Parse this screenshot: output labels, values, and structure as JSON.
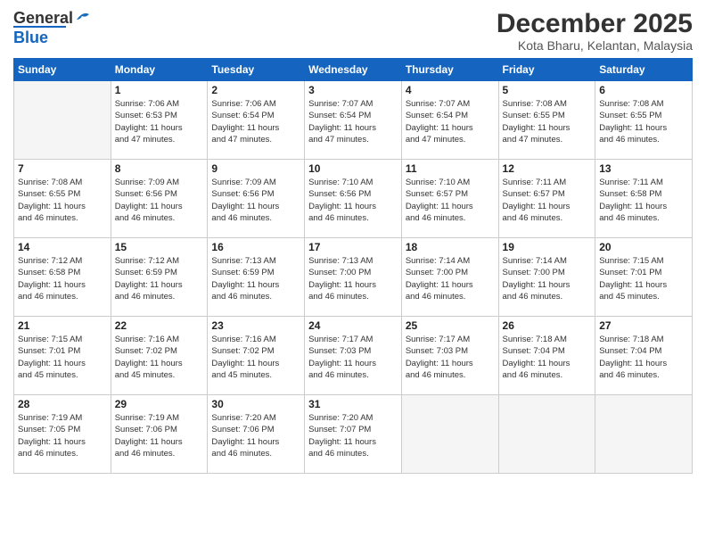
{
  "logo": {
    "line1": "General",
    "line2": "Blue"
  },
  "title": "December 2025",
  "subtitle": "Kota Bharu, Kelantan, Malaysia",
  "weekdays": [
    "Sunday",
    "Monday",
    "Tuesday",
    "Wednesday",
    "Thursday",
    "Friday",
    "Saturday"
  ],
  "weeks": [
    [
      {
        "day": "",
        "info": ""
      },
      {
        "day": "1",
        "info": "Sunrise: 7:06 AM\nSunset: 6:53 PM\nDaylight: 11 hours\nand 47 minutes."
      },
      {
        "day": "2",
        "info": "Sunrise: 7:06 AM\nSunset: 6:54 PM\nDaylight: 11 hours\nand 47 minutes."
      },
      {
        "day": "3",
        "info": "Sunrise: 7:07 AM\nSunset: 6:54 PM\nDaylight: 11 hours\nand 47 minutes."
      },
      {
        "day": "4",
        "info": "Sunrise: 7:07 AM\nSunset: 6:54 PM\nDaylight: 11 hours\nand 47 minutes."
      },
      {
        "day": "5",
        "info": "Sunrise: 7:08 AM\nSunset: 6:55 PM\nDaylight: 11 hours\nand 47 minutes."
      },
      {
        "day": "6",
        "info": "Sunrise: 7:08 AM\nSunset: 6:55 PM\nDaylight: 11 hours\nand 46 minutes."
      }
    ],
    [
      {
        "day": "7",
        "info": "Sunrise: 7:08 AM\nSunset: 6:55 PM\nDaylight: 11 hours\nand 46 minutes."
      },
      {
        "day": "8",
        "info": "Sunrise: 7:09 AM\nSunset: 6:56 PM\nDaylight: 11 hours\nand 46 minutes."
      },
      {
        "day": "9",
        "info": "Sunrise: 7:09 AM\nSunset: 6:56 PM\nDaylight: 11 hours\nand 46 minutes."
      },
      {
        "day": "10",
        "info": "Sunrise: 7:10 AM\nSunset: 6:56 PM\nDaylight: 11 hours\nand 46 minutes."
      },
      {
        "day": "11",
        "info": "Sunrise: 7:10 AM\nSunset: 6:57 PM\nDaylight: 11 hours\nand 46 minutes."
      },
      {
        "day": "12",
        "info": "Sunrise: 7:11 AM\nSunset: 6:57 PM\nDaylight: 11 hours\nand 46 minutes."
      },
      {
        "day": "13",
        "info": "Sunrise: 7:11 AM\nSunset: 6:58 PM\nDaylight: 11 hours\nand 46 minutes."
      }
    ],
    [
      {
        "day": "14",
        "info": "Sunrise: 7:12 AM\nSunset: 6:58 PM\nDaylight: 11 hours\nand 46 minutes."
      },
      {
        "day": "15",
        "info": "Sunrise: 7:12 AM\nSunset: 6:59 PM\nDaylight: 11 hours\nand 46 minutes."
      },
      {
        "day": "16",
        "info": "Sunrise: 7:13 AM\nSunset: 6:59 PM\nDaylight: 11 hours\nand 46 minutes."
      },
      {
        "day": "17",
        "info": "Sunrise: 7:13 AM\nSunset: 7:00 PM\nDaylight: 11 hours\nand 46 minutes."
      },
      {
        "day": "18",
        "info": "Sunrise: 7:14 AM\nSunset: 7:00 PM\nDaylight: 11 hours\nand 46 minutes."
      },
      {
        "day": "19",
        "info": "Sunrise: 7:14 AM\nSunset: 7:00 PM\nDaylight: 11 hours\nand 46 minutes."
      },
      {
        "day": "20",
        "info": "Sunrise: 7:15 AM\nSunset: 7:01 PM\nDaylight: 11 hours\nand 45 minutes."
      }
    ],
    [
      {
        "day": "21",
        "info": "Sunrise: 7:15 AM\nSunset: 7:01 PM\nDaylight: 11 hours\nand 45 minutes."
      },
      {
        "day": "22",
        "info": "Sunrise: 7:16 AM\nSunset: 7:02 PM\nDaylight: 11 hours\nand 45 minutes."
      },
      {
        "day": "23",
        "info": "Sunrise: 7:16 AM\nSunset: 7:02 PM\nDaylight: 11 hours\nand 45 minutes."
      },
      {
        "day": "24",
        "info": "Sunrise: 7:17 AM\nSunset: 7:03 PM\nDaylight: 11 hours\nand 46 minutes."
      },
      {
        "day": "25",
        "info": "Sunrise: 7:17 AM\nSunset: 7:03 PM\nDaylight: 11 hours\nand 46 minutes."
      },
      {
        "day": "26",
        "info": "Sunrise: 7:18 AM\nSunset: 7:04 PM\nDaylight: 11 hours\nand 46 minutes."
      },
      {
        "day": "27",
        "info": "Sunrise: 7:18 AM\nSunset: 7:04 PM\nDaylight: 11 hours\nand 46 minutes."
      }
    ],
    [
      {
        "day": "28",
        "info": "Sunrise: 7:19 AM\nSunset: 7:05 PM\nDaylight: 11 hours\nand 46 minutes."
      },
      {
        "day": "29",
        "info": "Sunrise: 7:19 AM\nSunset: 7:06 PM\nDaylight: 11 hours\nand 46 minutes."
      },
      {
        "day": "30",
        "info": "Sunrise: 7:20 AM\nSunset: 7:06 PM\nDaylight: 11 hours\nand 46 minutes."
      },
      {
        "day": "31",
        "info": "Sunrise: 7:20 AM\nSunset: 7:07 PM\nDaylight: 11 hours\nand 46 minutes."
      },
      {
        "day": "",
        "info": ""
      },
      {
        "day": "",
        "info": ""
      },
      {
        "day": "",
        "info": ""
      }
    ]
  ]
}
